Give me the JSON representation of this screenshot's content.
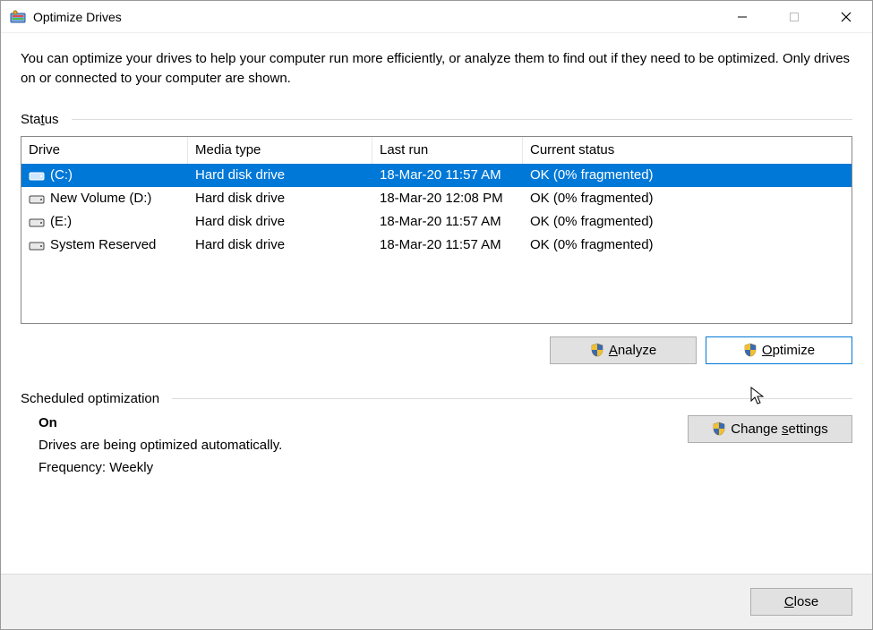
{
  "window": {
    "title": "Optimize Drives"
  },
  "description": "You can optimize your drives to help your computer run more efficiently, or analyze them to find out if they need to be optimized. Only drives on or connected to your computer are shown.",
  "status_label": "Status",
  "columns": {
    "drive": "Drive",
    "media": "Media type",
    "lastrun": "Last run",
    "status": "Current status"
  },
  "drives": [
    {
      "name": " (C:)",
      "media": "Hard disk drive",
      "lastrun": "18-Mar-20 11:57 AM",
      "status": "OK (0% fragmented)",
      "selected": true,
      "iconColor": "#fff"
    },
    {
      "name": "New Volume (D:)",
      "media": "Hard disk drive",
      "lastrun": "18-Mar-20 12:08 PM",
      "status": "OK (0% fragmented)",
      "selected": false,
      "iconColor": "#444"
    },
    {
      "name": " (E:)",
      "media": "Hard disk drive",
      "lastrun": "18-Mar-20 11:57 AM",
      "status": "OK (0% fragmented)",
      "selected": false,
      "iconColor": "#444"
    },
    {
      "name": "System Reserved",
      "media": "Hard disk drive",
      "lastrun": "18-Mar-20 11:57 AM",
      "status": "OK (0% fragmented)",
      "selected": false,
      "iconColor": "#444"
    }
  ],
  "buttons": {
    "analyze": "Analyze",
    "optimize": "Optimize",
    "change_settings": "Change settings",
    "close": "Close"
  },
  "scheduled": {
    "label": "Scheduled optimization",
    "state": "On",
    "desc": "Drives are being optimized automatically.",
    "freq": "Frequency: Weekly"
  }
}
